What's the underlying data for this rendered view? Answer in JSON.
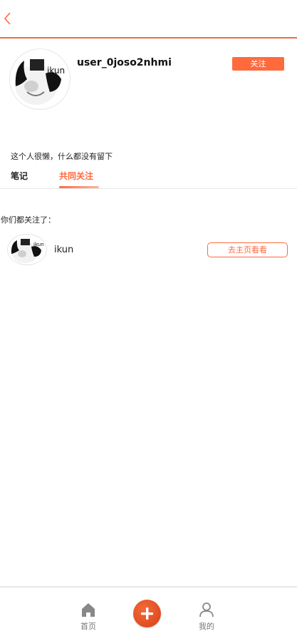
{
  "profile": {
    "username": "user_0joso2nhmi",
    "follow_label": "关注",
    "bio": "这个人很懒，什么都没有留下"
  },
  "tabs": [
    {
      "label": "笔记",
      "active": false
    },
    {
      "label": "共同关注",
      "active": true
    }
  ],
  "common": {
    "title": "你们都关注了：",
    "users": [
      {
        "name": "ikun",
        "action_label": "去主页看看",
        "avatar_icon": "meme-avatar-icon"
      }
    ]
  },
  "bottom_nav": {
    "home_label": "首页",
    "me_label": "我的"
  },
  "colors": {
    "accent": "#ff6a3d",
    "nav_icon": "#888888"
  }
}
